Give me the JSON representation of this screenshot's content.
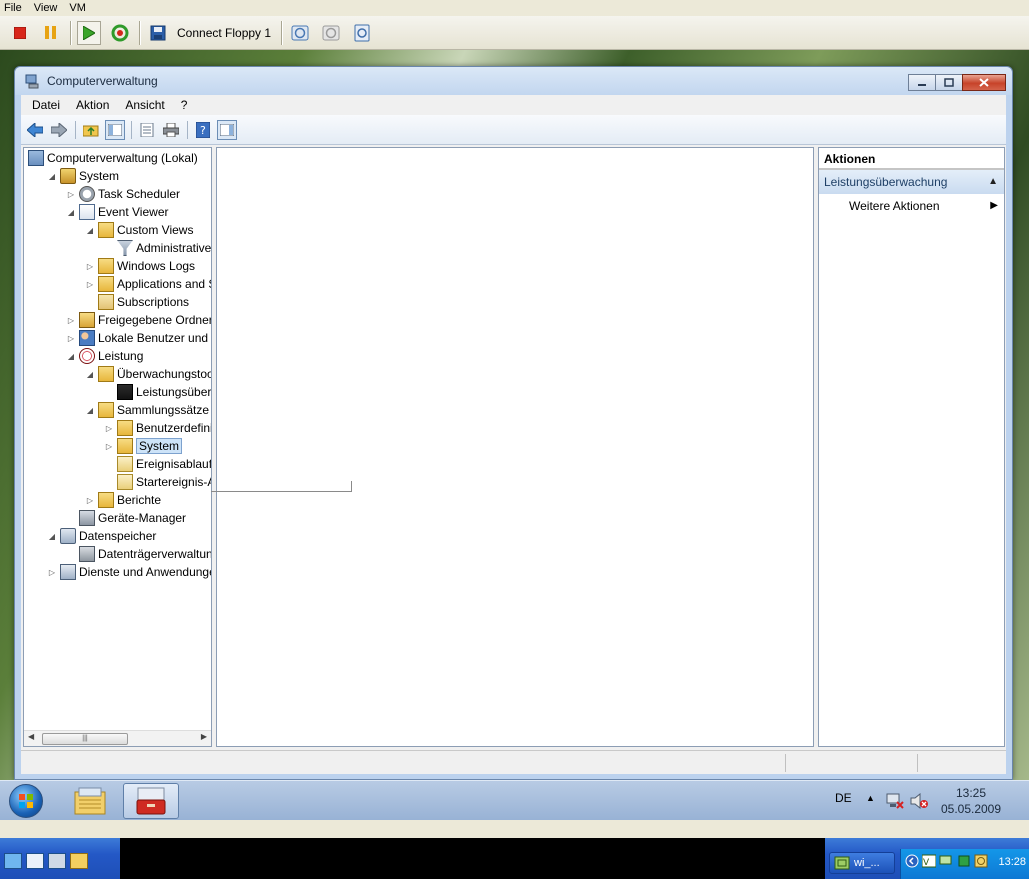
{
  "host": {
    "menu": [
      "File",
      "View",
      "VM"
    ],
    "toolbar": {
      "floppy_label": "Connect Floppy 1"
    },
    "taskbar": {
      "task_label": "wi_...",
      "clock": "13:28"
    }
  },
  "window": {
    "title": "Computerverwaltung",
    "menu": [
      "Datei",
      "Aktion",
      "Ansicht",
      "?"
    ]
  },
  "tree": [
    {
      "label": "Computerverwaltung (Lokal)",
      "depth": 0,
      "expander": "",
      "icon": "computer-management-icon"
    },
    {
      "label": "System",
      "depth": 1,
      "expander": "expanded",
      "icon": "system-tools-icon"
    },
    {
      "label": "Task Scheduler",
      "depth": 2,
      "expander": "collapsed",
      "icon": "clock-icon"
    },
    {
      "label": "Event Viewer",
      "depth": 2,
      "expander": "expanded",
      "icon": "event-viewer-icon"
    },
    {
      "label": "Custom Views",
      "depth": 3,
      "expander": "expanded",
      "icon": "folder-icon"
    },
    {
      "label": "Administrative E",
      "depth": 4,
      "expander": "",
      "icon": "filter-icon"
    },
    {
      "label": "Windows Logs",
      "depth": 3,
      "expander": "collapsed",
      "icon": "folder-logs-icon"
    },
    {
      "label": "Applications and Se",
      "depth": 3,
      "expander": "collapsed",
      "icon": "folder-logs-icon"
    },
    {
      "label": "Subscriptions",
      "depth": 3,
      "expander": "",
      "icon": "subscriptions-icon"
    },
    {
      "label": "Freigegebene Ordner",
      "depth": 2,
      "expander": "collapsed",
      "icon": "shared-folder-icon"
    },
    {
      "label": "Lokale Benutzer und Gr",
      "depth": 2,
      "expander": "collapsed",
      "icon": "users-icon"
    },
    {
      "label": "Leistung",
      "depth": 2,
      "expander": "expanded",
      "icon": "performance-icon"
    },
    {
      "label": "Überwachungstools",
      "depth": 3,
      "expander": "expanded",
      "icon": "folder-monitor-icon"
    },
    {
      "label": "Leistungsüberwa",
      "depth": 4,
      "expander": "",
      "icon": "perf-monitor-icon"
    },
    {
      "label": "Sammlungssätze",
      "depth": 3,
      "expander": "expanded",
      "icon": "folder-icon"
    },
    {
      "label": "Benutzerdefinier",
      "depth": 4,
      "expander": "collapsed",
      "icon": "folder-user-icon"
    },
    {
      "label": "System",
      "depth": 4,
      "expander": "collapsed",
      "icon": "folder-system-icon",
      "selected": true
    },
    {
      "label": "Ereignisablaufve",
      "depth": 4,
      "expander": "",
      "icon": "trace-icon"
    },
    {
      "label": "Startereignis-Ab",
      "depth": 4,
      "expander": "",
      "icon": "trace-icon"
    },
    {
      "label": "Berichte",
      "depth": 3,
      "expander": "collapsed",
      "icon": "reports-icon"
    },
    {
      "label": "Geräte-Manager",
      "depth": 2,
      "expander": "",
      "icon": "device-manager-icon"
    },
    {
      "label": "Datenspeicher",
      "depth": 1,
      "expander": "expanded",
      "icon": "storage-icon"
    },
    {
      "label": "Datenträgerverwaltung",
      "depth": 2,
      "expander": "",
      "icon": "disk-management-icon"
    },
    {
      "label": "Dienste und Anwendungen",
      "depth": 1,
      "expander": "collapsed",
      "icon": "services-icon"
    }
  ],
  "actions": {
    "title": "Aktionen",
    "section": "Leistungsüberwachung",
    "item": "Weitere Aktionen"
  },
  "guest_taskbar": {
    "language": "DE",
    "time": "13:25",
    "date": "05.05.2009"
  },
  "colors": {
    "selection": "#cde3f8",
    "actions_header": "#c9dbf0",
    "host_taskbar": "#2458c6"
  }
}
